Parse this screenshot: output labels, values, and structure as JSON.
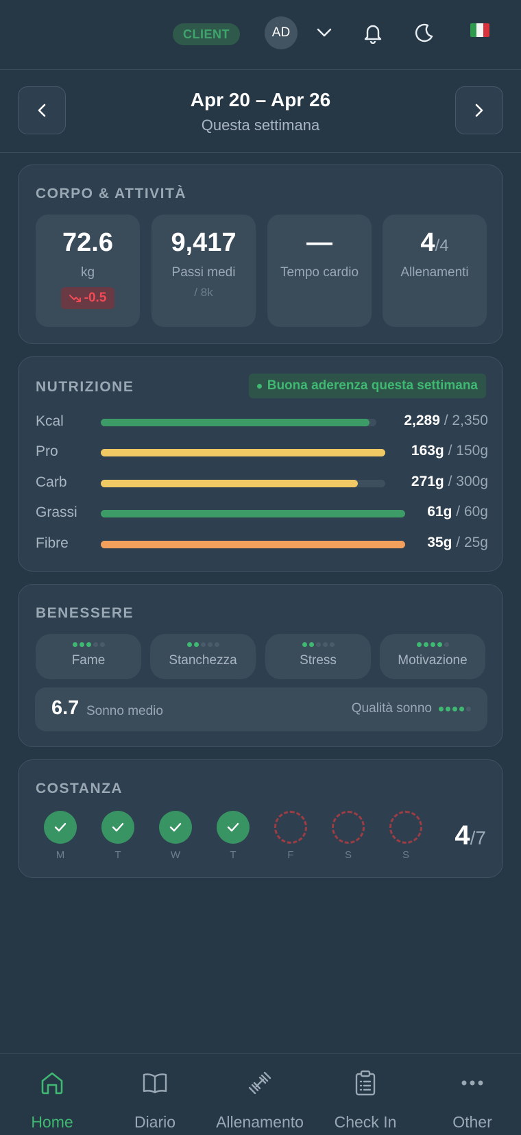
{
  "header": {
    "role_badge": "CLIENT",
    "avatar_initials": "AD",
    "language": "it",
    "icons": [
      "chevron-down-icon",
      "bell-icon",
      "moon-icon",
      "italy-flag-icon"
    ]
  },
  "week": {
    "range": "Apr 20 – Apr 26",
    "subtitle": "Questa settimana"
  },
  "corpo": {
    "title": "CORPO & ATTIVITÀ",
    "stats": [
      {
        "value": "72.6",
        "label": "kg",
        "delta": "-0.5"
      },
      {
        "value": "9,417",
        "label": "Passi medi",
        "sub": "/ 8k"
      },
      {
        "value": "—",
        "label": "Tempo cardio"
      },
      {
        "value": "4",
        "suffix": "/4",
        "label": "Allenamenti"
      }
    ]
  },
  "nutrizione": {
    "title": "NUTRIZIONE",
    "adherence": "Buona aderenza questa settimana",
    "rows": [
      {
        "label": "Kcal",
        "value": "2,289",
        "target": "/ 2,350",
        "fill": 0.974,
        "color": "#3d9b67"
      },
      {
        "label": "Pro",
        "value": "163g",
        "target": "/ 150g",
        "fill": 1.0,
        "color": "#f0c965"
      },
      {
        "label": "Carb",
        "value": "271g",
        "target": "/ 300g",
        "fill": 0.903,
        "color": "#f0c965"
      },
      {
        "label": "Grassi",
        "value": "61g",
        "target": "/ 60g",
        "fill": 1.0,
        "color": "#3d9b67"
      },
      {
        "label": "Fibre",
        "value": "35g",
        "target": "/ 25g",
        "fill": 1.0,
        "color": "#f3a05c"
      }
    ]
  },
  "benessere": {
    "title": "BENESSERE",
    "items": [
      {
        "label": "Fame",
        "level": 3
      },
      {
        "label": "Stanchezza",
        "level": 2
      },
      {
        "label": "Stress",
        "level": 2
      },
      {
        "label": "Motivazione",
        "level": 4
      }
    ],
    "sleep_value": "6.7",
    "sleep_label": "Sonno medio",
    "sleep_quality_label": "Qualità sonno",
    "sleep_quality_level": 4,
    "dot_on_color": "#3fb872",
    "dot_off_color": "#4a5b69"
  },
  "costanza": {
    "title": "COSTANZA",
    "days": [
      {
        "label": "M",
        "done": true
      },
      {
        "label": "T",
        "done": true
      },
      {
        "label": "W",
        "done": true
      },
      {
        "label": "T",
        "done": true
      },
      {
        "label": "F",
        "done": false
      },
      {
        "label": "S",
        "done": false
      },
      {
        "label": "S",
        "done": false
      }
    ],
    "total": "4",
    "total_of": "/7"
  },
  "nav": {
    "items": [
      {
        "label": "Home",
        "icon": "home-icon",
        "active": true
      },
      {
        "label": "Diario",
        "icon": "book-icon"
      },
      {
        "label": "Allenamento",
        "icon": "dumbbell-icon"
      },
      {
        "label": "Check In",
        "icon": "clipboard-icon"
      },
      {
        "label": "Other",
        "icon": "more-icon"
      }
    ]
  }
}
